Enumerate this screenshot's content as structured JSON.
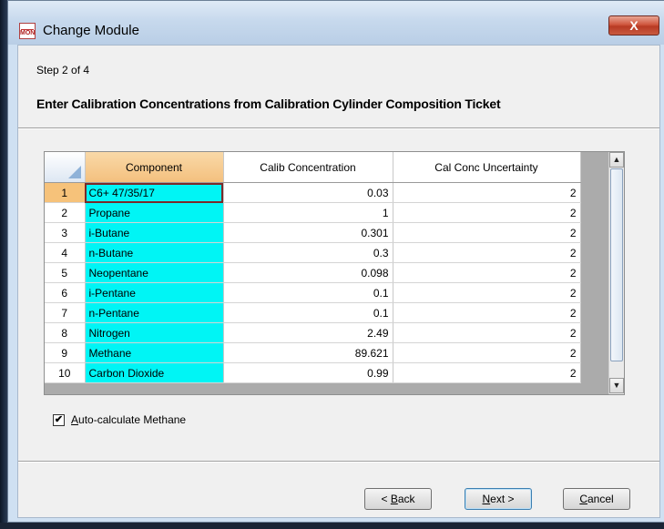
{
  "window": {
    "title": "Change Module",
    "icon_text": "MON",
    "close_glyph": "X"
  },
  "wizard": {
    "step": "Step 2 of 4",
    "heading": "Enter Calibration Concentrations from Calibration Cylinder Composition Ticket"
  },
  "grid": {
    "columns": [
      "Component",
      "Calib Concentration",
      "Cal Conc Uncertainty"
    ],
    "rows": [
      {
        "num": "1",
        "component": "C6+ 47/35/17",
        "calib": "0.03",
        "uncertainty": "2"
      },
      {
        "num": "2",
        "component": "Propane",
        "calib": "1",
        "uncertainty": "2"
      },
      {
        "num": "3",
        "component": "i-Butane",
        "calib": "0.301",
        "uncertainty": "2"
      },
      {
        "num": "4",
        "component": "n-Butane",
        "calib": "0.3",
        "uncertainty": "2"
      },
      {
        "num": "5",
        "component": "Neopentane",
        "calib": "0.098",
        "uncertainty": "2"
      },
      {
        "num": "6",
        "component": "i-Pentane",
        "calib": "0.1",
        "uncertainty": "2"
      },
      {
        "num": "7",
        "component": "n-Pentane",
        "calib": "0.1",
        "uncertainty": "2"
      },
      {
        "num": "8",
        "component": "Nitrogen",
        "calib": "2.49",
        "uncertainty": "2"
      },
      {
        "num": "9",
        "component": "Methane",
        "calib": "89.621",
        "uncertainty": "2"
      },
      {
        "num": "10",
        "component": "Carbon Dioxide",
        "calib": "0.99",
        "uncertainty": "2"
      }
    ]
  },
  "options": {
    "auto_calc_checked": "✔",
    "auto_calc_accel": "A",
    "auto_calc_rest": "uto-calculate Methane"
  },
  "buttons": {
    "back_pre": "< ",
    "back_accel": "B",
    "back_rest": "ack",
    "next_accel": "N",
    "next_rest": "ext >",
    "cancel_accel": "C",
    "cancel_rest": "ancel"
  },
  "colors": {
    "component_cell": "#00f5f5",
    "selected_header": "#f6c27a"
  }
}
